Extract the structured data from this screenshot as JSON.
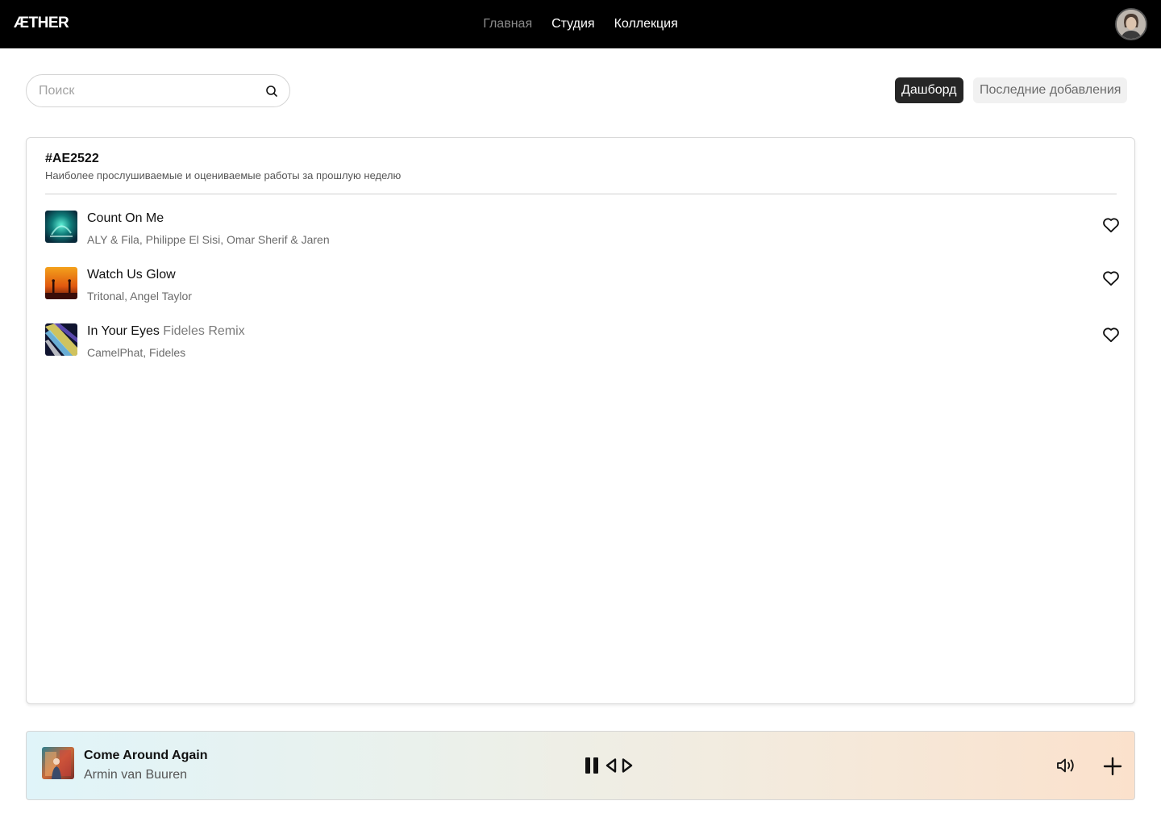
{
  "app": {
    "logo": "ÆTHER",
    "nav": [
      {
        "label": "Главная",
        "active": false
      },
      {
        "label": "Студия",
        "active": true
      },
      {
        "label": "Коллекция",
        "active": true
      }
    ]
  },
  "search": {
    "placeholder": "Поиск",
    "value": ""
  },
  "tabs": [
    {
      "label": "Дашборд",
      "selected": true
    },
    {
      "label": "Последние добавления",
      "selected": false
    }
  ],
  "card": {
    "title": "#AE2522",
    "subtitle": "Наиболее прослушиваемые и оцениваемые работы за прошлую неделю",
    "tracks": [
      {
        "title": "Count On Me",
        "remix": "",
        "artists": "ALY & Fila, Philippe El Sisi, Omar Sherif & Jaren"
      },
      {
        "title": "Watch Us Glow",
        "remix": "",
        "artists": "Tritonal, Angel Taylor"
      },
      {
        "title": "In Your Eyes",
        "remix": "Fideles Remix",
        "artists": "CamelPhat, Fideles"
      }
    ]
  },
  "player": {
    "title": "Come Around Again",
    "artist": "Armin van Buuren",
    "state": "playing"
  },
  "colors": {
    "topbar": "#000000",
    "active_tab": "#262626",
    "player_gradient_start": "#e0f4f9",
    "player_gradient_end": "#fbe1cc"
  },
  "icons": [
    "search-icon",
    "heart-icon",
    "pause-icon",
    "previous-icon",
    "next-icon",
    "volume-icon",
    "plus-icon"
  ]
}
